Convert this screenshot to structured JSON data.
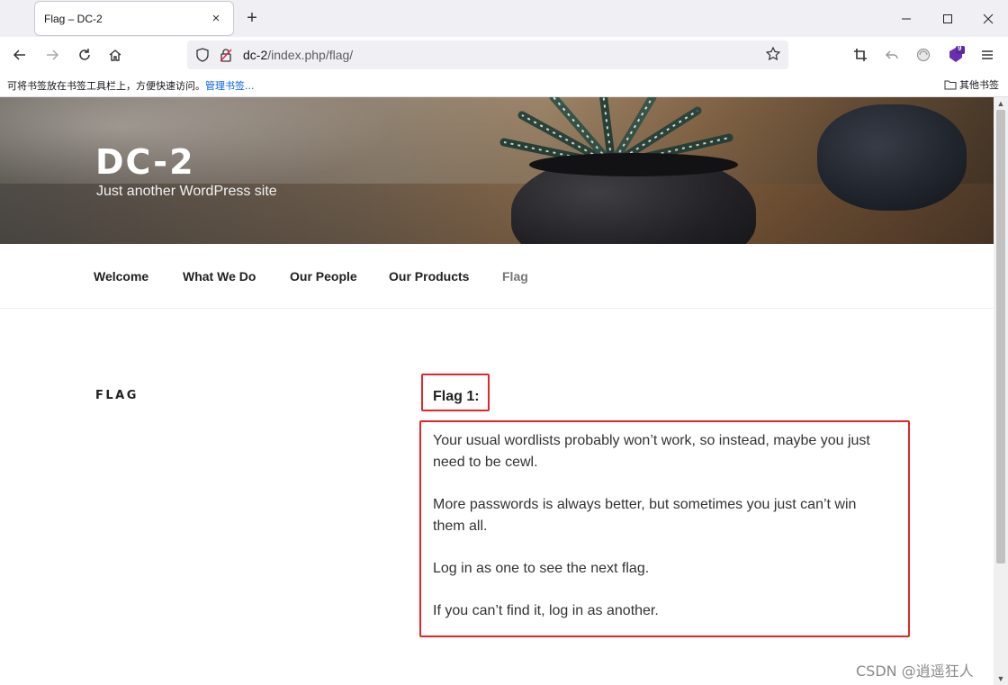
{
  "browser": {
    "tab_title": "Flag – DC-2",
    "tab_close": "×",
    "new_tab": "+",
    "url_host": "dc-2",
    "url_path": "/index.php/flag/",
    "extension_badge": "9",
    "bookmarks_hint": "可将书签放在书签工具栏上，方便快速访问。",
    "bookmarks_manage": "管理书签...",
    "bookmarks_other": "其他书签"
  },
  "site": {
    "title": "DC-2",
    "description": "Just another WordPress site"
  },
  "menu": {
    "items": [
      "Welcome",
      "What We Do",
      "Our People",
      "Our Products",
      "Flag"
    ],
    "current": "Flag"
  },
  "page": {
    "title": "FLAG",
    "flag_heading": "Flag 1:",
    "paragraphs": [
      "Your usual wordlists probably won’t work, so instead, maybe you just need to be cewl.",
      "More passwords is always better, but sometimes you just can’t win them all.",
      "Log in as one to see the next flag.",
      "If you can’t find it, log in as another."
    ]
  },
  "watermark": "CSDN @逍遥狂人",
  "icons": [
    "back-icon",
    "forward-icon",
    "reload-icon",
    "home-icon",
    "shield-icon",
    "insecure-lock-icon",
    "star-icon",
    "crop-icon",
    "undo-icon",
    "extension-icon",
    "menu-icon",
    "minimize-icon",
    "maximize-icon",
    "close-window-icon",
    "folder-icon"
  ]
}
